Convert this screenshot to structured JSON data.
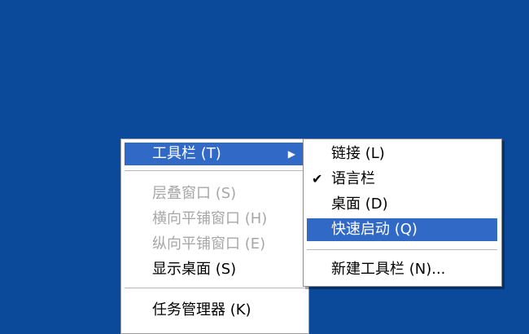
{
  "colors": {
    "desktop": "#0b4a9a",
    "highlight": "#3169c6",
    "menu_bg": "#ffffff",
    "disabled_text": "#a7a7a7"
  },
  "context_menu": {
    "toolbar": "工具栏 (T)",
    "cascade": "层叠窗口 (S)",
    "tile_horizontal": "横向平铺窗口 (H)",
    "tile_vertical": "纵向平铺窗口 (E)",
    "show_desktop": "显示桌面 (S)",
    "task_manager": "任务管理器 (K)",
    "submenu_arrow_icon": "triangle-right"
  },
  "toolbar_submenu": {
    "links": "链接 (L)",
    "language_bar": "语言栏",
    "language_bar_checked": true,
    "desktop": "桌面 (D)",
    "quick_launch": "快速启动 (Q)",
    "new_toolbar": "新建工具栏 (N)..."
  }
}
